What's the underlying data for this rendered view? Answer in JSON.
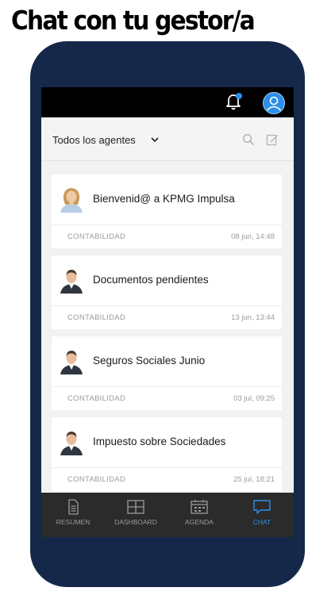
{
  "promo": {
    "title": "Chat con tu gestor/a"
  },
  "header": {
    "filter_label": "Todos los agentes"
  },
  "icons": {
    "bell": "bell-icon",
    "avatar": "user-avatar-icon",
    "search": "search-icon",
    "compose": "compose-icon"
  },
  "colors": {
    "accent": "#2c8fe8",
    "phone_frame": "#16284a",
    "tabbar": "#2b2b2b"
  },
  "chats": [
    {
      "title": "Bienvenid@ a KPMG Impulsa",
      "category": "CONTABILIDAD",
      "date": "08 jun, 14:48",
      "avatar": "female-agent"
    },
    {
      "title": "Documentos pendientes",
      "category": "CONTABILIDAD",
      "date": "13 jun, 13:44",
      "avatar": "male-agent"
    },
    {
      "title": "Seguros Sociales Junio",
      "category": "CONTABILIDAD",
      "date": "03 jul, 09:25",
      "avatar": "male-agent"
    },
    {
      "title": "Impuesto sobre Sociedades",
      "category": "CONTABILIDAD",
      "date": "25 jul, 18:21",
      "avatar": "male-agent"
    }
  ],
  "tabs": [
    {
      "label": "RESUMEN",
      "icon": "document-icon",
      "active": false
    },
    {
      "label": "DASHBOARD",
      "icon": "dashboard-grid-icon",
      "active": false
    },
    {
      "label": "AGENDA",
      "icon": "calendar-icon",
      "active": false
    },
    {
      "label": "CHAT",
      "icon": "chat-bubble-icon",
      "active": true
    }
  ]
}
